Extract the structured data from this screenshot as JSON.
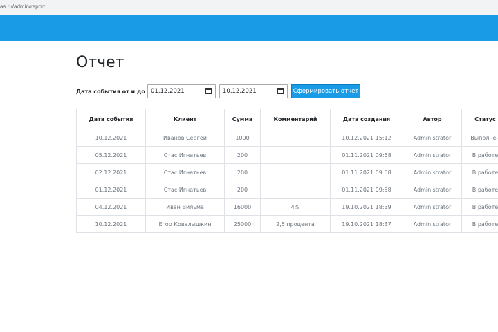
{
  "browser": {
    "url": "as.ru/admin/report"
  },
  "page": {
    "title": "Отчет"
  },
  "filter": {
    "label": "Дата события от и до",
    "from_date": "01.12.2021",
    "to_date": "10.12.2021",
    "submit_label": "Сформировать отчет"
  },
  "table": {
    "headers": [
      "Дата события",
      "Клиент",
      "Сумма",
      "Комментарий",
      "Дата создания",
      "Автор",
      "Статус"
    ],
    "rows": [
      [
        "10.12.2021",
        "Иванов Сергей",
        "1000",
        "",
        "10.12.2021 15:12",
        "Administrator",
        "Выполнен"
      ],
      [
        "05.12.2021",
        "Стас Игнатьев",
        "200",
        "",
        "01.11.2021 09:58",
        "Administrator",
        "В работе"
      ],
      [
        "02.12.2021",
        "Стас Игнатьев",
        "200",
        "",
        "01.11.2021 09:58",
        "Administrator",
        "В работе"
      ],
      [
        "01.12.2021",
        "Стас Игнатьев",
        "200",
        "",
        "01.11.2021 09:58",
        "Administrator",
        "В работе"
      ],
      [
        "04.12.2021",
        "Иван Вильма",
        "16000",
        "4%",
        "19.10.2021 18:39",
        "Administrator",
        "В работе"
      ],
      [
        "10.12.2021",
        "Егор Ковалышкин",
        "25000",
        "2,5 процента",
        "19.10.2021 18:37",
        "Administrator",
        "В работе"
      ]
    ]
  },
  "icons": {
    "date_picker": "calendar-icon"
  },
  "colors": {
    "navbar": "#1a9be6",
    "button": "#1a9be6"
  }
}
